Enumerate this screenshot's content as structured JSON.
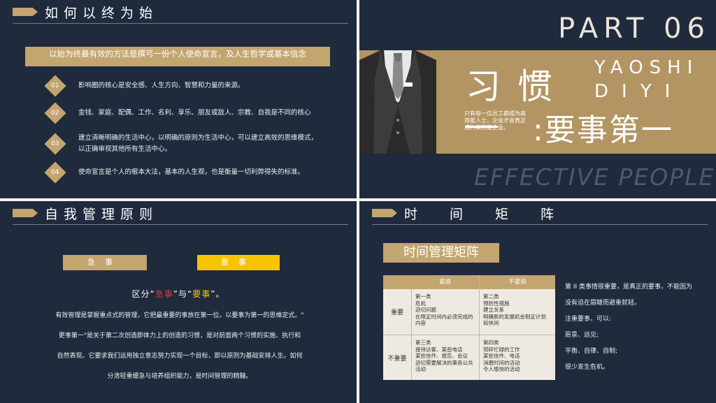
{
  "slide1": {
    "heading": "如何以终为始",
    "banner": "以始为终最有效的方法是撰弓一份个人使命宣言，及人生哲学或基本信念",
    "items": [
      {
        "num": "01",
        "text": "影响圈的核心是安全感、人生方向、智慧和力量的来源。"
      },
      {
        "num": "02",
        "text": "金钱、家庭、配偶、工作、名利、享乐、朋友或敌人、宗教、自我是不同的核心"
      },
      {
        "num": "03",
        "text": "建立清晰明确的生活中心，以明确的原则为生活中心，可以建立高效的思维模式，以正确审视其他所有生活中心。"
      },
      {
        "num": "04",
        "text": "使命宣言是个人的根本大法，基本的人生观，也是衡量一切利弊得失的标准。"
      }
    ]
  },
  "slide2": {
    "part": "PART 06",
    "xi": "习惯",
    "yaoshi": "YAOSHI",
    "diyi": "DIYI",
    "big": ":要事第一",
    "small": "只有每一位员工都成为高效能人士，企业才会真正成为高效能企业。",
    "effective": "EFFECTIVE PEOPLE"
  },
  "slide3": {
    "heading": "自我管理原则",
    "tag_a": "急事",
    "tag_b": "要事",
    "d_prefix": "区分“",
    "d_red": "急事",
    "d_mid": "”与“",
    "d_yel": "要事",
    "d_suffix": "”。",
    "para": "有效管理是掌握重点式的管理，它把最重要的事放在第一位。以要事为第一的思维定式。\"\n更事第一\"是关于第二次创造即体力上的创造的习惯，是对前面两个习惯的实施、执行和\n自然表现。它要求我们运用独立意志努力实现一个目标，即以原则为基础安排人生。如何\n分清轻重缓急与培养组织能力，是时间管理的精髓。"
  },
  "slide4": {
    "heading": "时间矩阵",
    "title": "时间管理矩阵",
    "col1": "紧迫",
    "col2": "不紧迫",
    "row1": "重要",
    "row2": "不重要",
    "c11": "第一类\n危机\n迫切问题\n在限定时间内必须完成的内容",
    "c12": "第二类\n预防性措施\n建立关系\n明确新的发展机会制定计划和休闲",
    "c21": "第三类\n接待访客、某些电话\n某些信件、报告、会议\n迫切需要解决的事务公共活动",
    "c22": "第四类\n琐碎忙碌的工作\n某些信件、电话\n消磨时间的活动\n令人愉快的活动",
    "right": [
      "第 II 类事情很重要，是真正的要事，不能因为",
      "没有迫在眉睫而避重就轻。",
      "注重要事，可以:",
      "愿景、远见;",
      "平衡、自律、自制;",
      "很少发生危机。"
    ]
  }
}
